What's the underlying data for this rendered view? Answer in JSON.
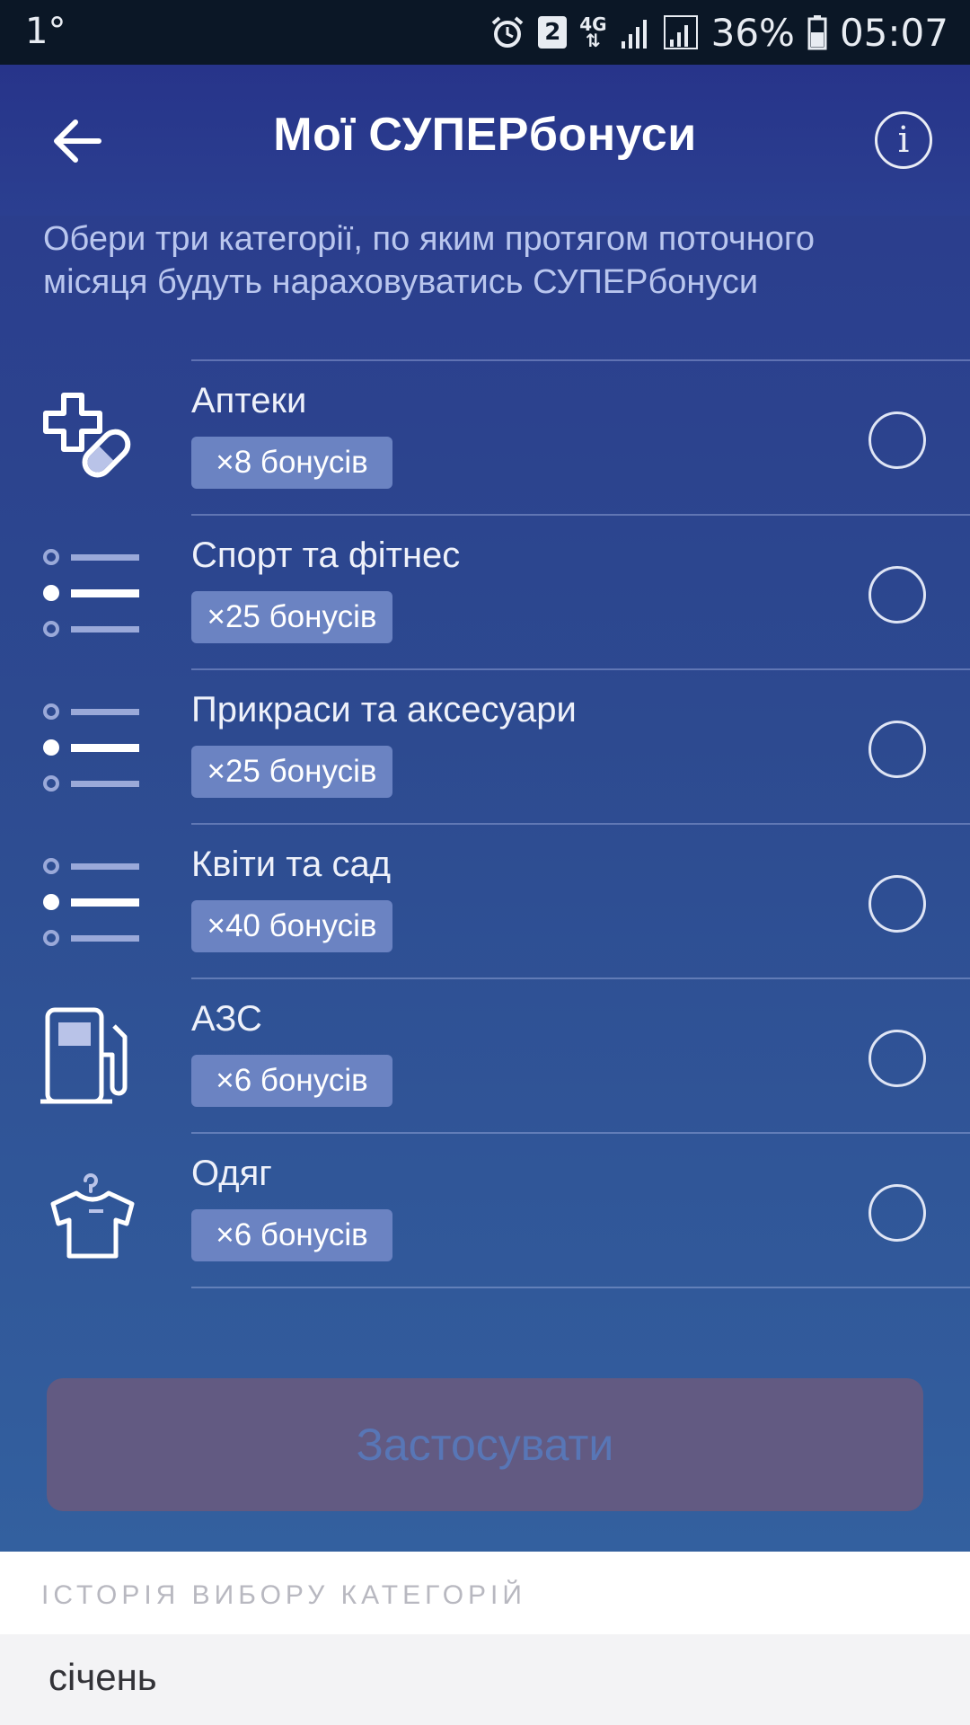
{
  "status_bar": {
    "left": "1°",
    "sim": "2",
    "network": "4G",
    "battery": "36%",
    "time": "05:07"
  },
  "header": {
    "title": "Мої СУПЕРбонуси",
    "info_label": "i"
  },
  "intro": "Обери три категорії, по яким протягом поточного місяця будуть нараховуватись СУПЕРбонуси",
  "categories": [
    {
      "name": "Аптеки",
      "bonus": "×8 бонусів",
      "icon": "pharmacy-icon"
    },
    {
      "name": "Спорт та фітнес",
      "bonus": "×25 бонусів",
      "icon": "list-icon"
    },
    {
      "name": "Прикраси та аксесуари",
      "bonus": "×25 бонусів",
      "icon": "list-icon"
    },
    {
      "name": "Квіти та сад",
      "bonus": "×40 бонусів",
      "icon": "list-icon"
    },
    {
      "name": "АЗС",
      "bonus": "×6 бонусів",
      "icon": "fuel-pump-icon"
    },
    {
      "name": "Одяг",
      "bonus": "×6 бонусів",
      "icon": "t-shirt-icon"
    }
  ],
  "apply_button": "Застосувати",
  "history": {
    "title": "ІСТОРІЯ ВИБОРУ КАТЕГОРІЙ",
    "months": [
      "січень"
    ]
  },
  "colors": {
    "gradient_top": "#2a3a8c",
    "gradient_bottom": "#33609f",
    "badge": "#6b83c2",
    "apply_bg": "#625a82",
    "apply_text": "#5876b6"
  }
}
